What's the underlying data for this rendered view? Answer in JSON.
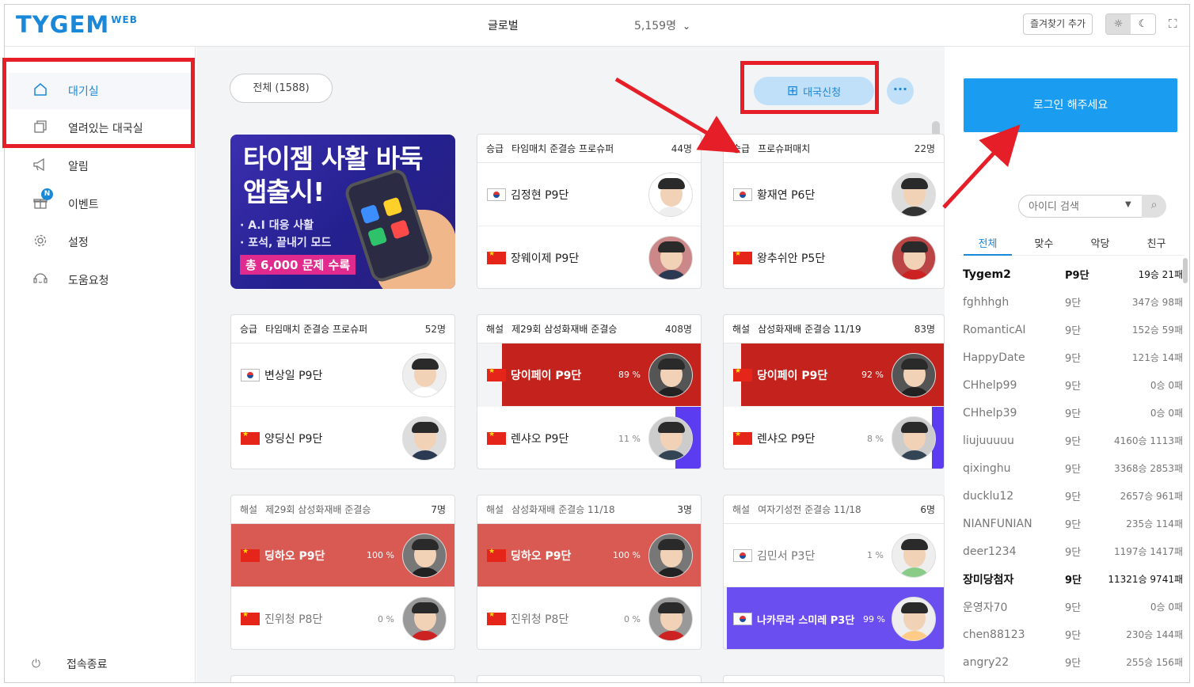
{
  "header": {
    "logo": "TYGEM",
    "logo_sup": "WEB",
    "server": "글로벌",
    "user_count": "5,159명",
    "favorites_label": "즐겨찾기 추가"
  },
  "sidebar": {
    "items": [
      {
        "label": "대기실",
        "icon": "home-icon"
      },
      {
        "label": "열려있는 대국실",
        "icon": "window-icon"
      },
      {
        "label": "알림",
        "icon": "megaphone-icon"
      },
      {
        "label": "이벤트",
        "icon": "gift-icon",
        "badge": "N"
      },
      {
        "label": "설정",
        "icon": "gear-icon"
      },
      {
        "label": "도움요청",
        "icon": "headset-icon"
      }
    ],
    "logout": "접속종료"
  },
  "main": {
    "filter": "전체 (1588)",
    "apply_label": "대국신청",
    "banner": {
      "title_line1": "타이젬 사활 바둑",
      "title_line2": "앱출시!",
      "bullet1": "· A.I 대응 사활",
      "bullet2": "· 포석, 끝내기 모드",
      "tag": "총 6,000 문제 수록"
    },
    "cards": [
      {
        "type": "승급",
        "title": "타임매치 준결승 프로슈퍼",
        "count": "44명",
        "p1": {
          "flag": "kr",
          "name": "김정현 P9단",
          "pct": ""
        },
        "p2": {
          "flag": "cn",
          "name": "장웨이제 P9단",
          "pct": ""
        }
      },
      {
        "type": "승급",
        "title": "프로슈퍼매치",
        "count": "22명",
        "p1": {
          "flag": "kr",
          "name": "황재연 P6단",
          "pct": ""
        },
        "p2": {
          "flag": "cn",
          "name": "왕추쉬안 P5단",
          "pct": ""
        }
      },
      {
        "type": "승급",
        "title": "타임매치 준결승 프로슈퍼",
        "count": "52명",
        "p1": {
          "flag": "kr",
          "name": "변상일 P9단",
          "pct": ""
        },
        "p2": {
          "flag": "cn",
          "name": "양딩신 P9단",
          "pct": ""
        }
      },
      {
        "type": "해설",
        "title": "제29회 삼성화재배 준결승",
        "count": "408명",
        "p1": {
          "flag": "cn",
          "name": "당이페이 P9단",
          "pct": "89 %"
        },
        "p2": {
          "flag": "cn",
          "name": "렌샤오 P9단",
          "pct": "11 %"
        }
      },
      {
        "type": "해설",
        "title": "삼성화재배 준결승 11/19",
        "count": "83명",
        "p1": {
          "flag": "cn",
          "name": "당이페이 P9단",
          "pct": "92 %"
        },
        "p2": {
          "flag": "cn",
          "name": "렌샤오 P9단",
          "pct": "8 %"
        }
      },
      {
        "type": "해설",
        "title": "제29회 삼성화재배 준결승",
        "count": "7명",
        "p1": {
          "flag": "cn",
          "name": "딩하오 P9단",
          "pct": "100 %"
        },
        "p2": {
          "flag": "cn",
          "name": "진위청 P8단",
          "pct": "0 %"
        }
      },
      {
        "type": "해설",
        "title": "삼성화재배 준결승 11/18",
        "count": "3명",
        "p1": {
          "flag": "cn",
          "name": "딩하오 P9단",
          "pct": "100 %"
        },
        "p2": {
          "flag": "cn",
          "name": "진위청 P8단",
          "pct": "0 %"
        }
      },
      {
        "type": "해설",
        "title": "여자기성전 준결승 11/18",
        "count": "6명",
        "p1": {
          "flag": "kr",
          "name": "김민서 P3단",
          "pct": "1 %"
        },
        "p2": {
          "flag": "kr",
          "name": "나카무라 스미레 P3단",
          "pct": "99 %"
        }
      }
    ]
  },
  "right": {
    "login_label": "로그인 해주세요",
    "search_placeholder": "아이디 검색",
    "tabs": [
      "전체",
      "맞수",
      "악당",
      "친구"
    ],
    "users": [
      {
        "id": "Tygem2",
        "rank": "P9단",
        "record": "19승 21패"
      },
      {
        "id": "fghhhgh",
        "rank": "9단",
        "record": "347승 98패"
      },
      {
        "id": "RomanticAI",
        "rank": "9단",
        "record": "152승 59패"
      },
      {
        "id": "HappyDate",
        "rank": "9단",
        "record": "121승 14패"
      },
      {
        "id": "CHhelp99",
        "rank": "9단",
        "record": "0승 0패"
      },
      {
        "id": "CHhelp39",
        "rank": "9단",
        "record": "0승 0패"
      },
      {
        "id": "liujuuuuu",
        "rank": "9단",
        "record": "4160승 1113패"
      },
      {
        "id": "qixinghu",
        "rank": "9단",
        "record": "3368승 2853패"
      },
      {
        "id": "ducklu12",
        "rank": "9단",
        "record": "2657승 961패"
      },
      {
        "id": "NIANFUNIAN",
        "rank": "9단",
        "record": "235승 114패"
      },
      {
        "id": "deer1234",
        "rank": "9단",
        "record": "1197승 1417패"
      },
      {
        "id": "장미당첨자",
        "rank": "9단",
        "record": "11321승 9741패"
      },
      {
        "id": "운영자70",
        "rank": "9단",
        "record": "0승 0패"
      },
      {
        "id": "chen88123",
        "rank": "9단",
        "record": "230승 144패"
      },
      {
        "id": "angry22",
        "rank": "9단",
        "record": "255승 156패"
      }
    ]
  },
  "colors": {
    "accent": "#1a88d8",
    "highlight": "#e61e27",
    "win": "#c4231d",
    "purple": "#6a4ef0"
  }
}
